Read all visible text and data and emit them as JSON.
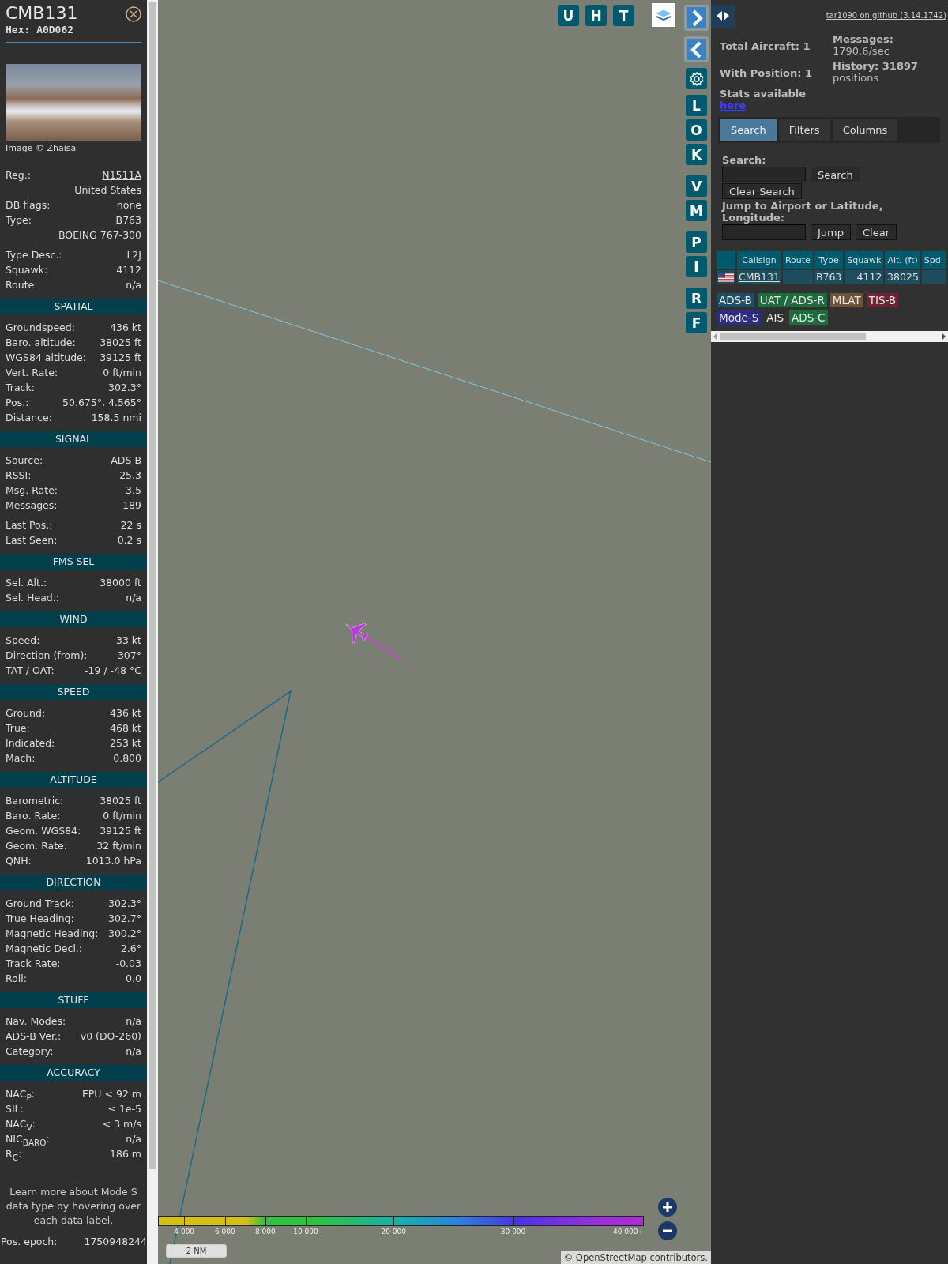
{
  "detail": {
    "title": "CMB131",
    "hex": "Hex: A0D062",
    "photo_credit": "Image © Zhaisa",
    "sections": [
      {
        "groups": [
          [
            {
              "label": "Reg.:",
              "value": "N1511A",
              "link": true
            },
            {
              "value": "United States"
            },
            {
              "label": "DB flags:",
              "value": "none"
            },
            {
              "label": "Type:",
              "value": "B763"
            },
            {
              "value": "BOEING 767-300"
            }
          ],
          [
            {
              "label": "Type Desc.:",
              "value": "L2J"
            },
            {
              "label": "Squawk:",
              "value": "4112"
            },
            {
              "label": "Route:",
              "value": "n/a"
            }
          ]
        ]
      },
      {
        "title": "SPATIAL",
        "groups": [
          [
            {
              "label": "Groundspeed:",
              "value": "436 kt"
            },
            {
              "label": "Baro. altitude:",
              "value": "38025 ft"
            },
            {
              "label": "WGS84 altitude:",
              "value": "39125 ft"
            },
            {
              "label": "Vert. Rate:",
              "value": "0 ft/min"
            },
            {
              "label": "Track:",
              "value": "302.3°"
            },
            {
              "label": "Pos.:",
              "value": "50.675°, 4.565°"
            },
            {
              "label": "Distance:",
              "value": "158.5 nmi"
            }
          ]
        ]
      },
      {
        "title": "SIGNAL",
        "groups": [
          [
            {
              "label": "Source:",
              "value": "ADS-B"
            },
            {
              "label": "RSSI:",
              "value": "-25.3"
            },
            {
              "label": "Msg. Rate:",
              "value": "3.5"
            },
            {
              "label": "Messages:",
              "value": "189"
            }
          ],
          [
            {
              "label": "Last Pos.:",
              "value": "22 s"
            },
            {
              "label": "Last Seen:",
              "value": "0.2 s"
            }
          ]
        ]
      },
      {
        "title": "FMS SEL",
        "groups": [
          [
            {
              "label": "Sel. Alt.:",
              "value": "38000 ft"
            },
            {
              "label": "Sel. Head.:",
              "value": "n/a"
            }
          ]
        ]
      },
      {
        "title": "WIND",
        "groups": [
          [
            {
              "label": "Speed:",
              "value": "33 kt"
            },
            {
              "label": "Direction (from):",
              "value": "307°"
            },
            {
              "label": "TAT / OAT:",
              "value": "-19 / -48 °C"
            }
          ]
        ]
      },
      {
        "title": "SPEED",
        "groups": [
          [
            {
              "label": "Ground:",
              "value": "436 kt"
            },
            {
              "label": "True:",
              "value": "468 kt"
            },
            {
              "label": "Indicated:",
              "value": "253 kt"
            },
            {
              "label": "Mach:",
              "value": "0.800"
            }
          ]
        ]
      },
      {
        "title": "ALTITUDE",
        "groups": [
          [
            {
              "label": "Barometric:",
              "value": "38025 ft"
            },
            {
              "label": "Baro. Rate:",
              "value": "0 ft/min"
            },
            {
              "label": "Geom. WGS84:",
              "value": "39125 ft"
            },
            {
              "label": "Geom. Rate:",
              "value": "32 ft/min"
            },
            {
              "label": "QNH:",
              "value": "1013.0 hPa"
            }
          ]
        ]
      },
      {
        "title": "DIRECTION",
        "groups": [
          [
            {
              "label": "Ground Track:",
              "value": "302.3°"
            },
            {
              "label": "True Heading:",
              "value": "302.7°"
            },
            {
              "label": "Magnetic Heading:",
              "value": "300.2°"
            },
            {
              "label": "Magnetic Decl.:",
              "value": "2.6°"
            },
            {
              "label": "Track Rate:",
              "value": "-0.03"
            },
            {
              "label": "Roll:",
              "value": "0.0"
            }
          ]
        ]
      },
      {
        "title": "STUFF",
        "groups": [
          [
            {
              "label": "Nav. Modes:",
              "value": "n/a"
            },
            {
              "label": "ADS-B Ver.:",
              "value": "v0 (DO-260)"
            },
            {
              "label": "Category:",
              "value": "n/a"
            }
          ]
        ]
      },
      {
        "title": "ACCURACY",
        "groups": [
          [
            {
              "label": "NAC$_{P}$:",
              "value": "EPU < 92 m"
            },
            {
              "label": "SIL:",
              "value": "≤ 1e-5"
            },
            {
              "label": "NAC$_{V}$:",
              "value": "< 3 m/s"
            },
            {
              "label": "NIC$_{BARO}$:",
              "value": "n/a"
            },
            {
              "label": "R$_{C}$:",
              "value": "186 m"
            }
          ]
        ]
      }
    ],
    "note": "Learn more about Mode S data type by hovering over each data label.",
    "epoch": {
      "label": "Pos. epoch:",
      "value": "1750948244"
    }
  },
  "map": {
    "top_buttons": [
      "U",
      "H",
      "T"
    ],
    "side_button_groups": [
      [
        "L",
        "O",
        "K"
      ],
      [
        "V",
        "M"
      ],
      [
        "P",
        "I"
      ],
      [
        "R",
        "F"
      ]
    ],
    "altitude_legend": [
      "4 000",
      "6 000",
      "8 000",
      "10 000",
      "20 000",
      "30 000",
      "40 000+"
    ],
    "scale": "2 NM",
    "attribution": "© OpenStreetMap contributors."
  },
  "panel": {
    "github_link": "tar1090 on github (3.14.1742)",
    "total": "Total Aircraft: 1",
    "with_position": "With Position: 1",
    "messages": "**Messages:** 1790.6/sec",
    "history": "**History: 31897** positions",
    "stats_note": "Stats available",
    "stats_link": "here",
    "tabs": [
      {
        "label": "Search",
        "selected": true
      },
      {
        "label": "Filters",
        "selected": false
      },
      {
        "label": "Columns",
        "selected": false
      }
    ],
    "search_label": "Search:",
    "search_button": "Search",
    "clear_search_button": "Clear Search",
    "jump_label": "Jump to Airport or Latitude, Longitude:",
    "jump_button": "Jump",
    "clear_button": "Clear",
    "table": {
      "columns": [
        "Callsign",
        "Route",
        "Type",
        "Squawk",
        "Alt. (ft)",
        "Spd."
      ],
      "rows": [
        {
          "cells": [
            "CMB131",
            null,
            "B763",
            "4112",
            "38025",
            null
          ]
        }
      ]
    },
    "sources": [
      {
        "label": "ADS-B",
        "color": "#1f4f66"
      },
      {
        "label": "UAT / ADS-R",
        "color": "#1e6b3e"
      },
      {
        "label": "MLAT",
        "color": "#6e5235"
      },
      {
        "label": "TIS-B",
        "color": "#6e2633"
      },
      {
        "label": "Mode-S",
        "color": "#2c2c80"
      },
      {
        "label": "AIS",
        "color": "#313131"
      },
      {
        "label": "ADS-C",
        "color": "#1e6b3e"
      }
    ]
  }
}
